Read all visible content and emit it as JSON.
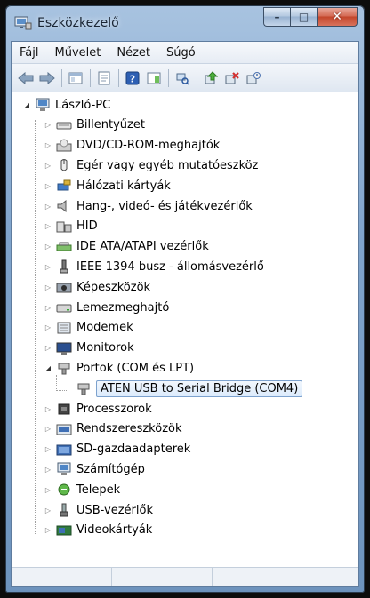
{
  "window": {
    "title": "Eszközkezelő",
    "close_glyph": "✕",
    "max_glyph": "□",
    "min_glyph": "–"
  },
  "menu": {
    "items": [
      "Fájl",
      "Művelet",
      "Nézet",
      "Súgó"
    ]
  },
  "toolbar": {
    "icons": [
      "back-arrow-icon",
      "forward-arrow-icon",
      "console-tree-icon",
      "properties-icon",
      "help-icon",
      "action-pane-icon",
      "scan-hardware-icon",
      "update-driver-icon",
      "uninstall-icon",
      "disable-icon"
    ]
  },
  "tree": {
    "root": "László-PC",
    "categories": [
      {
        "label": "Billentyűzet",
        "icon": "keyboard-icon"
      },
      {
        "label": "DVD/CD-ROM-meghajtók",
        "icon": "dvd-drive-icon"
      },
      {
        "label": "Egér vagy egyéb mutatóeszköz",
        "icon": "mouse-icon"
      },
      {
        "label": "Hálózati kártyák",
        "icon": "network-adapter-icon"
      },
      {
        "label": "Hang-, videó- és játékvezérlők",
        "icon": "sound-icon"
      },
      {
        "label": "HID",
        "icon": "hid-icon"
      },
      {
        "label": "IDE ATA/ATAPI vezérlők",
        "icon": "ide-controller-icon"
      },
      {
        "label": "IEEE 1394 busz - állomásvezérlő",
        "icon": "ieee1394-icon"
      },
      {
        "label": "Képeszközök",
        "icon": "imaging-device-icon"
      },
      {
        "label": "Lemezmeghajtó",
        "icon": "disk-drive-icon"
      },
      {
        "label": "Modemek",
        "icon": "modem-icon"
      },
      {
        "label": "Monitorok",
        "icon": "monitor-icon"
      },
      {
        "label": "Portok (COM és LPT)",
        "icon": "port-icon",
        "expanded": true
      },
      {
        "label": "ATEN USB to Serial Bridge (COM4)",
        "icon": "port-icon",
        "child": true,
        "selected": true
      },
      {
        "label": "Processzorok",
        "icon": "processor-icon"
      },
      {
        "label": "Rendszereszközök",
        "icon": "system-device-icon"
      },
      {
        "label": "SD-gazdaadapterek",
        "icon": "sd-host-icon"
      },
      {
        "label": "Számítógép",
        "icon": "computer-icon"
      },
      {
        "label": "Telepek",
        "icon": "battery-icon"
      },
      {
        "label": "USB-vezérlők",
        "icon": "usb-icon"
      },
      {
        "label": "Videokártyák",
        "icon": "display-adapter-icon"
      }
    ]
  },
  "colors": {
    "title_bar": "#7fa4cc",
    "close_button": "#c3452a",
    "selection_border": "#7da2ce"
  }
}
